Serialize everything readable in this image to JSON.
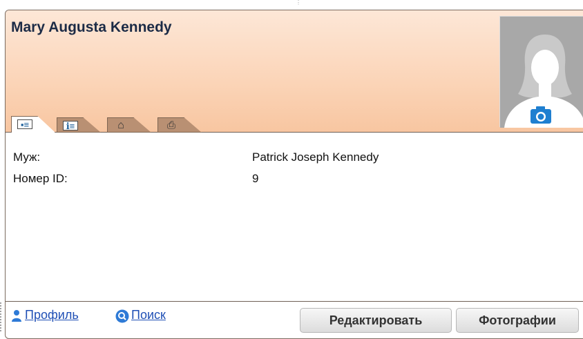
{
  "person": {
    "name": "Mary Augusta Kennedy"
  },
  "tabs": [
    {
      "icon": "id-card-icon",
      "active": true
    },
    {
      "icon": "details-card-icon",
      "active": false
    },
    {
      "icon": "house-icon",
      "active": false
    },
    {
      "icon": "inbox-tray-icon",
      "active": false
    }
  ],
  "fields": [
    {
      "label": "Муж:",
      "value": "Patrick Joseph Kennedy"
    },
    {
      "label": "Номер ID:",
      "value": "9"
    }
  ],
  "footer": {
    "profile_link": "Профиль",
    "search_link": "Поиск",
    "edit_button": "Редактировать",
    "photos_button": "Фотографии"
  },
  "colors": {
    "header_top": "#fde7d7",
    "header_bottom": "#f8c6a1",
    "tab": "#b99073",
    "link": "#1f4fb5",
    "camera_blue": "#1f7fd0"
  }
}
